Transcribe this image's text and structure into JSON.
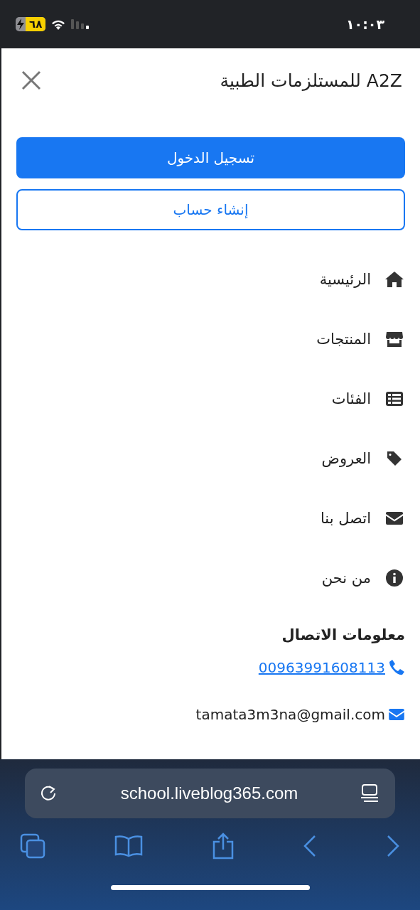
{
  "status_bar": {
    "time": "١٠:٠٣",
    "battery": "٦٨",
    "charging": true
  },
  "drawer": {
    "title": "A2Z للمستلزمات الطبية",
    "buttons": [
      {
        "label": "تسجيل الدخول",
        "kind": "primary"
      },
      {
        "label": "إنشاء حساب",
        "kind": "outline"
      }
    ],
    "menu": [
      {
        "label": "الرئيسية",
        "kind": "home"
      },
      {
        "label": "المنتجات",
        "kind": "store"
      },
      {
        "label": "الفئات",
        "kind": "list"
      },
      {
        "label": "العروض",
        "kind": "tag"
      },
      {
        "label": "اتصل بنا",
        "kind": "envelope"
      },
      {
        "label": "من نحن",
        "kind": "info"
      }
    ],
    "contact": {
      "heading": "معلومات الاتصال",
      "items": [
        {
          "kind": "phone",
          "text": "00963991608113"
        },
        {
          "kind": "email",
          "text": "tamata3m3na@gmail.com"
        }
      ]
    }
  },
  "browser": {
    "url": "school.liveblog365.com"
  }
}
